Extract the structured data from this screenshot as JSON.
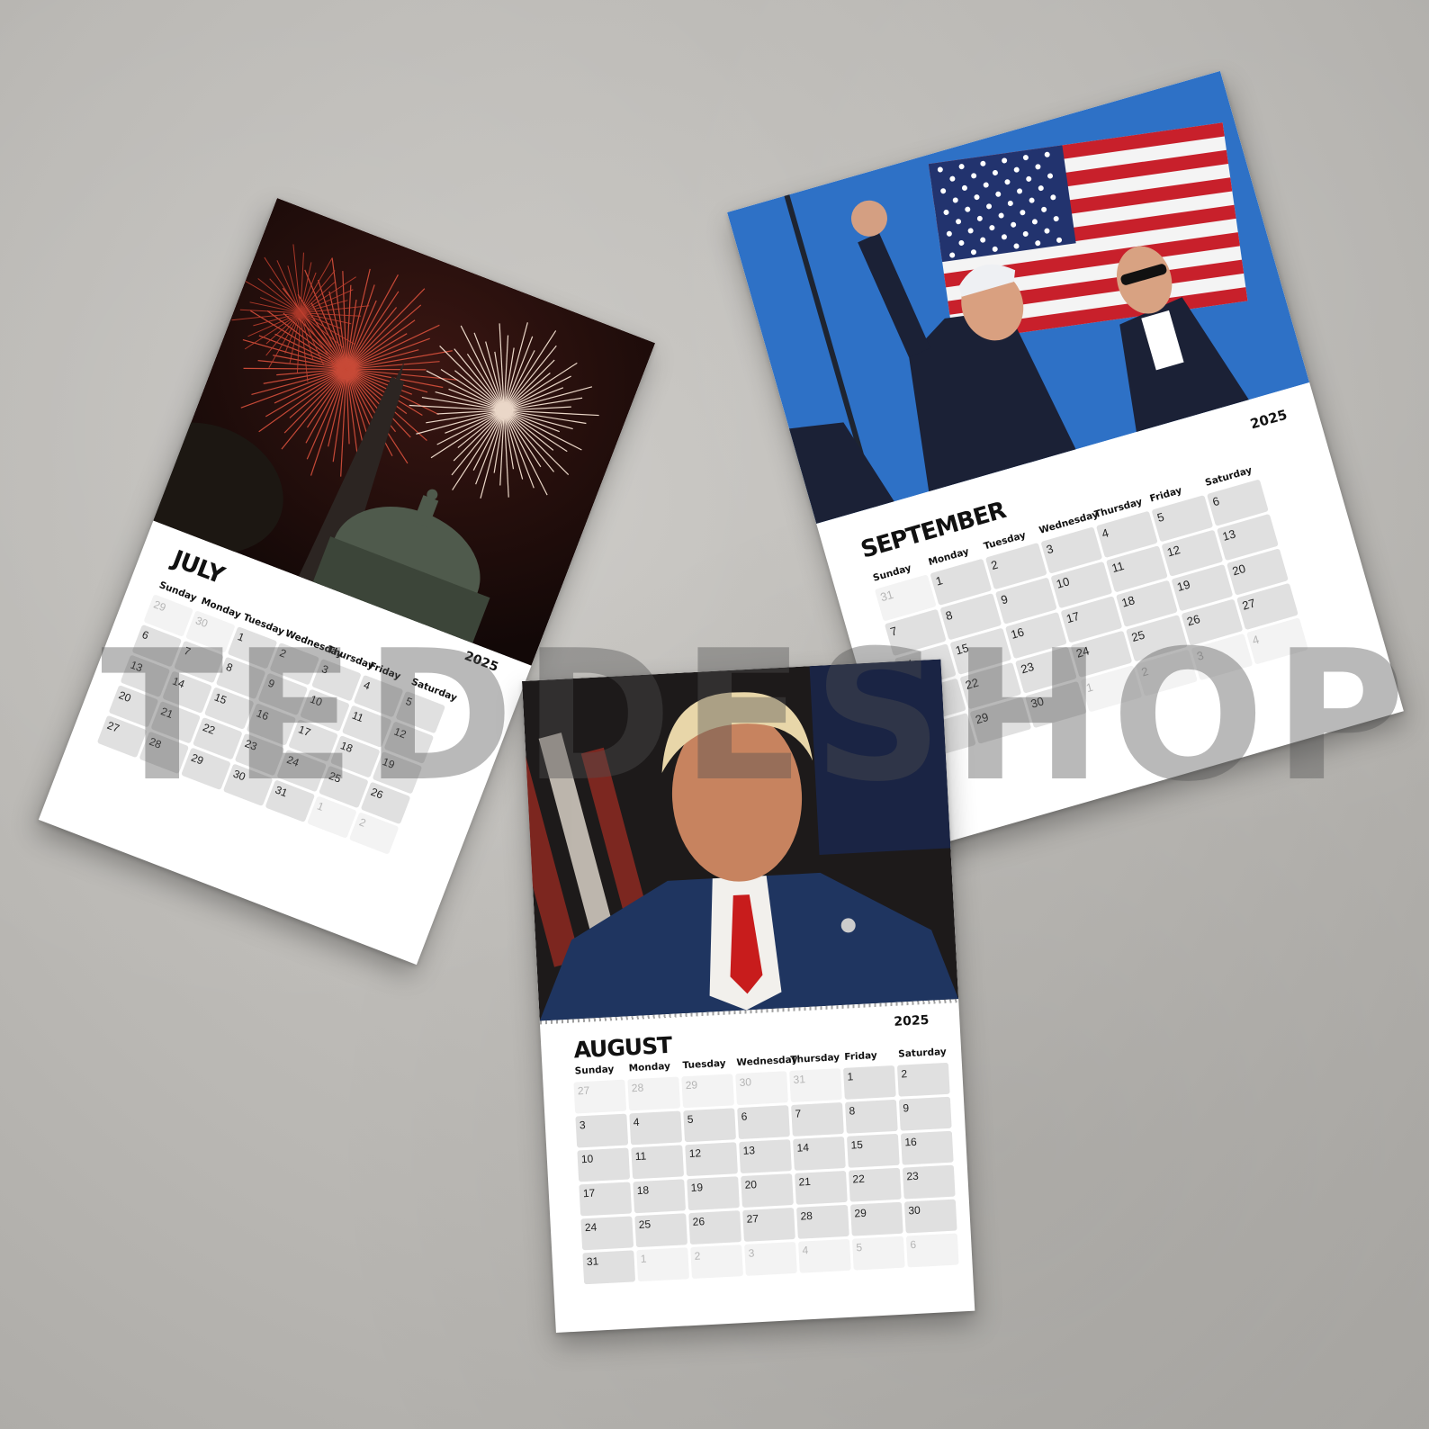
{
  "calendars": {
    "july": {
      "month": "JULY",
      "year": "2025",
      "days": [
        "Sunday",
        "Monday",
        "Tuesday",
        "Wednesday",
        "Thursday",
        "Friday",
        "Saturday"
      ],
      "photo": "fireworks over Washington Monument and Capitol dome"
    },
    "august": {
      "month": "AUGUST",
      "year": "2025",
      "days": [
        "Sunday",
        "Monday",
        "Tuesday",
        "Wednesday",
        "Thursday",
        "Friday",
        "Saturday"
      ],
      "photo": "portrait of man in suit with red tie, flag behind"
    },
    "september": {
      "month": "SEPTEMBER",
      "year": "2025",
      "days": [
        "Sunday",
        "Monday",
        "Tuesday",
        "Wednesday",
        "Thursday",
        "Friday",
        "Saturday"
      ],
      "photo": "raised fist in front of American flag with security agent"
    }
  },
  "watermark": "TEDDESHOP",
  "colors": {
    "cell": "#e0e0e0",
    "muted_cell": "#f3f3f3",
    "background": "#bdbbb7"
  }
}
